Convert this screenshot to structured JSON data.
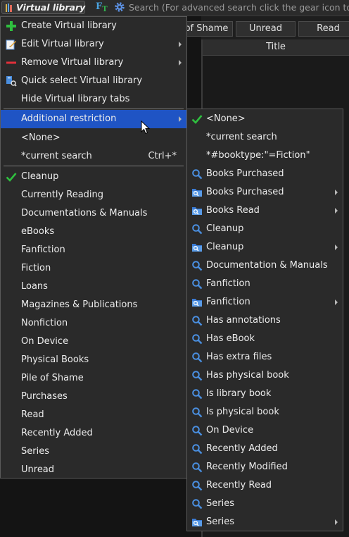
{
  "toolbar": {
    "virtual_library_label": "Virtual library",
    "ft_label": "F",
    "ft_sub": "T",
    "search_placeholder": "Search (For advanced search click the gear icon to t"
  },
  "columns": {
    "tabs": [
      "of Shame",
      "Unread",
      "Read"
    ],
    "header": "Title"
  },
  "vl_menu": {
    "actions": [
      {
        "label": "Create Virtual library",
        "icon": "plus-icon",
        "submenu": false
      },
      {
        "label": "Edit Virtual library",
        "icon": "edit-icon",
        "submenu": true
      },
      {
        "label": "Remove Virtual library",
        "icon": "minus-icon",
        "submenu": true
      },
      {
        "label": "Quick select Virtual library",
        "icon": "quick-select-icon",
        "submenu": false
      },
      {
        "label": "Hide Virtual library tabs",
        "icon": "",
        "submenu": false
      }
    ],
    "additional_restriction": "Additional restriction",
    "none_label": "<None>",
    "current_search_label": "*current search",
    "current_search_shortcut": "Ctrl+*",
    "libraries": [
      "Cleanup",
      "Currently Reading",
      "Documentations & Manuals",
      "eBooks",
      "Fanfiction",
      "Fiction",
      "Loans",
      "Magazines & Publications",
      "Nonfiction",
      "On Device",
      "Physical Books",
      "Pile of Shame",
      "Purchases",
      "Read",
      "Recently Added",
      "Series",
      "Unread"
    ],
    "checked_library": "Cleanup"
  },
  "restriction_menu": {
    "items": [
      {
        "label": "<None>",
        "icon": "checkmark-icon",
        "submenu": false
      },
      {
        "label": "*current search",
        "icon": "",
        "submenu": false
      },
      {
        "label": "*#booktype:\"=Fiction\"",
        "icon": "",
        "submenu": false
      },
      {
        "label": "Books Purchased",
        "icon": "search-icon",
        "submenu": false
      },
      {
        "label": "Books Purchased",
        "icon": "folder-search-icon",
        "submenu": true
      },
      {
        "label": "Books Read",
        "icon": "folder-search-icon",
        "submenu": true
      },
      {
        "label": "Cleanup",
        "icon": "search-icon",
        "submenu": false
      },
      {
        "label": "Cleanup",
        "icon": "folder-search-icon",
        "submenu": true
      },
      {
        "label": "Documentation & Manuals",
        "icon": "search-icon",
        "submenu": false
      },
      {
        "label": "Fanfiction",
        "icon": "search-icon",
        "submenu": false
      },
      {
        "label": "Fanfiction",
        "icon": "folder-search-icon",
        "submenu": true
      },
      {
        "label": "Has annotations",
        "icon": "search-icon",
        "submenu": false
      },
      {
        "label": "Has eBook",
        "icon": "search-icon",
        "submenu": false
      },
      {
        "label": "Has extra files",
        "icon": "search-icon",
        "submenu": false
      },
      {
        "label": "Has physical book",
        "icon": "search-icon",
        "submenu": false
      },
      {
        "label": "Is library book",
        "icon": "search-icon",
        "submenu": false
      },
      {
        "label": "Is physical book",
        "icon": "search-icon",
        "submenu": false
      },
      {
        "label": "On Device",
        "icon": "search-icon",
        "submenu": false
      },
      {
        "label": "Recently Added",
        "icon": "search-icon",
        "submenu": false
      },
      {
        "label": "Recently Modified",
        "icon": "search-icon",
        "submenu": false
      },
      {
        "label": "Recently Read",
        "icon": "search-icon",
        "submenu": false
      },
      {
        "label": "Series",
        "icon": "search-icon",
        "submenu": false
      },
      {
        "label": "Series",
        "icon": "folder-search-icon",
        "submenu": true
      }
    ]
  },
  "colors": {
    "highlight": "#1f54c4",
    "menu_bg": "#2a2a2a",
    "check": "#2fbf3f",
    "search_icon": "#4a8fe0"
  }
}
